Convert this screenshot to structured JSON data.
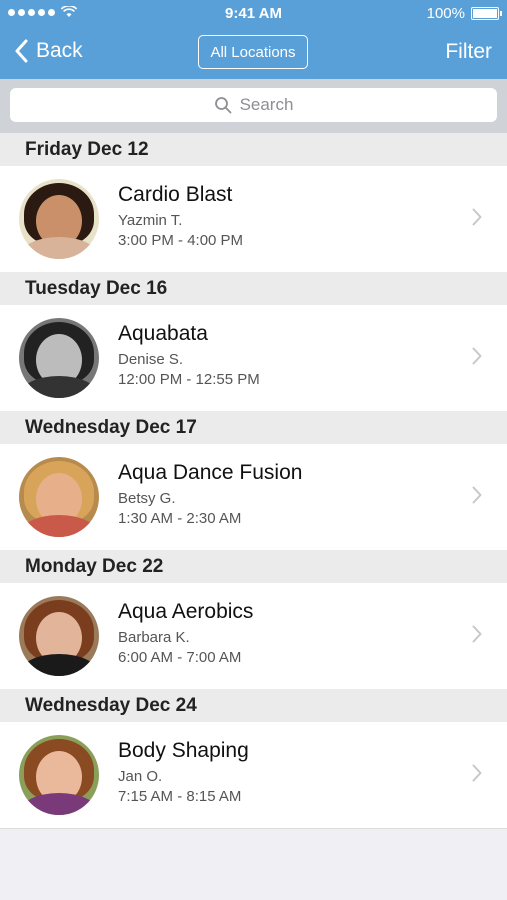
{
  "status": {
    "time": "9:41 AM",
    "battery": "100%"
  },
  "nav": {
    "back_label": "Back",
    "locations_label": "All Locations",
    "filter_label": "Filter"
  },
  "search": {
    "placeholder": "Search"
  },
  "sections": [
    {
      "date": "Friday Dec 12",
      "class": "Cardio Blast",
      "instructor": "Yazmin T.",
      "time": "3:00 PM - 4:00 PM"
    },
    {
      "date": "Tuesday Dec 16",
      "class": "Aquabata",
      "instructor": "Denise S.",
      "time": "12:00 PM - 12:55 PM"
    },
    {
      "date": "Wednesday Dec 17",
      "class": "Aqua Dance Fusion",
      "instructor": "Betsy G.",
      "time": "1:30 AM - 2:30 AM"
    },
    {
      "date": "Monday Dec 22",
      "class": "Aqua Aerobics",
      "instructor": "Barbara K.",
      "time": "6:00 AM - 7:00 AM"
    },
    {
      "date": "Wednesday Dec 24",
      "class": "Body Shaping",
      "instructor": "Jan O.",
      "time": "7:15 AM - 8:15 AM"
    }
  ],
  "colors": {
    "accent": "#5aa0d8",
    "section_bg": "#ebebeb",
    "page_bg": "#efeff4"
  }
}
